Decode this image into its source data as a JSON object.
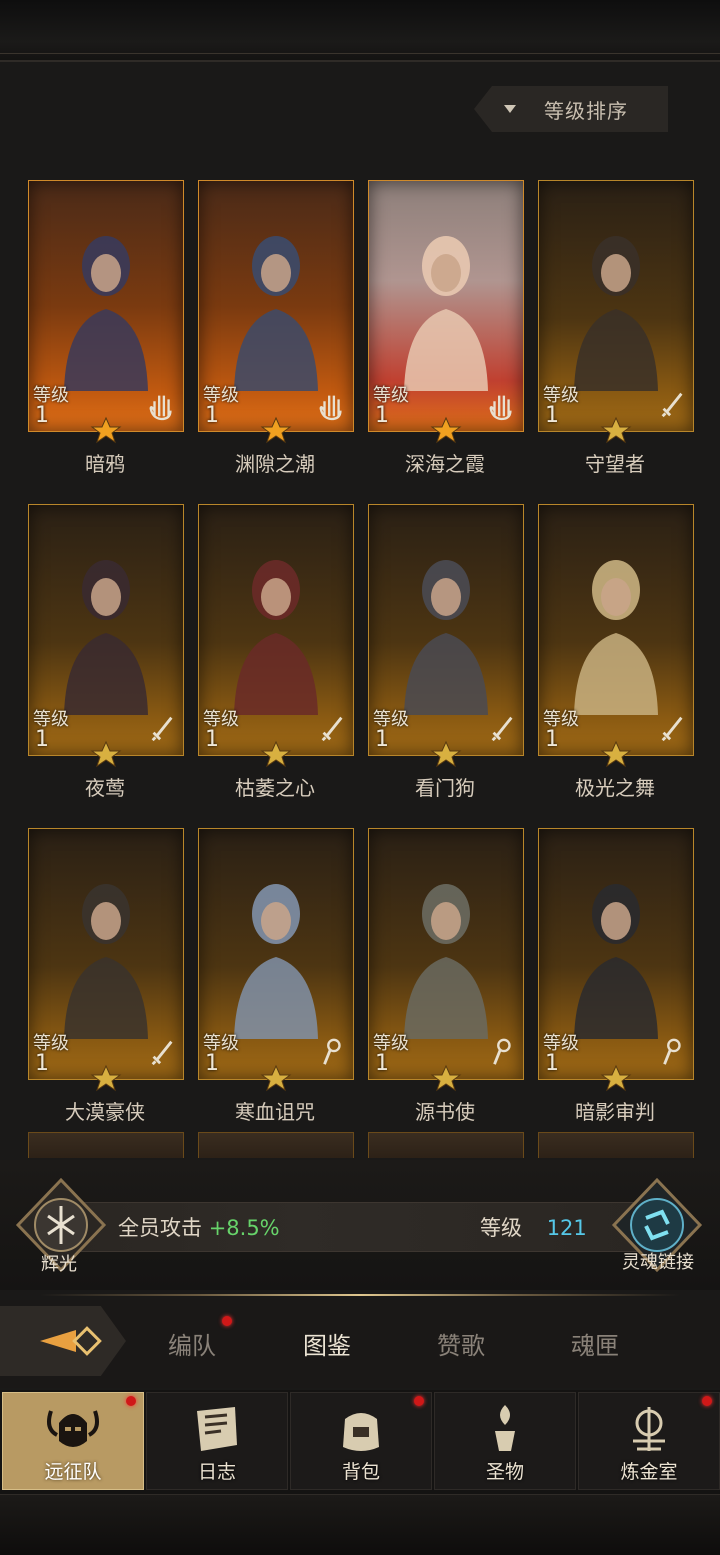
{
  "sort_button": {
    "label": "等级排序"
  },
  "level_label": "等级",
  "heroes": [
    {
      "name": "暗鸦",
      "level": "1",
      "class_icon": "hand-icon",
      "frame": "red"
    },
    {
      "name": "渊隙之潮",
      "level": "1",
      "class_icon": "hand-icon",
      "frame": "red"
    },
    {
      "name": "深海之霞",
      "level": "1",
      "class_icon": "hand-icon",
      "frame": "light"
    },
    {
      "name": "守望者",
      "level": "1",
      "class_icon": "sword-icon",
      "frame": "gold"
    },
    {
      "name": "夜莺",
      "level": "1",
      "class_icon": "sword-icon",
      "frame": "gold"
    },
    {
      "name": "枯萎之心",
      "level": "1",
      "class_icon": "sword-icon",
      "frame": "gold"
    },
    {
      "name": "看门狗",
      "level": "1",
      "class_icon": "sword-icon",
      "frame": "gold"
    },
    {
      "name": "极光之舞",
      "level": "1",
      "class_icon": "sword-icon",
      "frame": "gold"
    },
    {
      "name": "大漠豪侠",
      "level": "1",
      "class_icon": "sword-icon",
      "frame": "gold"
    },
    {
      "name": "寒血诅咒",
      "level": "1",
      "class_icon": "staff-icon",
      "frame": "gold"
    },
    {
      "name": "源书使",
      "level": "1",
      "class_icon": "staff-icon",
      "frame": "gold"
    },
    {
      "name": "暗影审判",
      "level": "1",
      "class_icon": "staff-icon",
      "frame": "gold"
    }
  ],
  "bonus": {
    "left_label": "辉光",
    "attack_text": "全员攻击",
    "attack_value": "+8.5%",
    "level_text": "等级",
    "level_value": "121",
    "right_label": "灵魂链接"
  },
  "sub_tabs": [
    {
      "label": "编队",
      "badge": true
    },
    {
      "label": "图鉴",
      "active": true
    },
    {
      "label": "赞歌"
    },
    {
      "label": "魂匣"
    }
  ],
  "bottom_nav": [
    {
      "label": "远征队",
      "active": true,
      "badge": true,
      "icon": "helmet-icon"
    },
    {
      "label": "日志",
      "icon": "scroll-icon"
    },
    {
      "label": "背包",
      "badge": true,
      "icon": "bag-icon"
    },
    {
      "label": "圣物",
      "icon": "relic-icon"
    },
    {
      "label": "炼金室",
      "badge": true,
      "icon": "alchemy-icon"
    }
  ],
  "colors": {
    "attack_green": "#67d36a",
    "level_cyan": "#56c8e8",
    "badge_red": "#d01818",
    "gold_frame": "#b8862a"
  }
}
